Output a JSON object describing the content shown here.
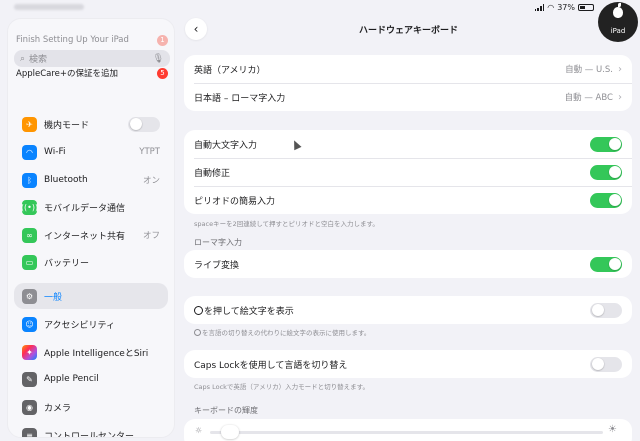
{
  "status_bar": {
    "battery": "37%"
  },
  "corner_logo": {
    "text": "iPad"
  },
  "sidebar": {
    "setup_items": [
      {
        "label": "Finish Setting Up Your iPad",
        "count": "1"
      },
      {
        "label": "AppleCare+の保証を追加",
        "count": "5"
      }
    ],
    "search_placeholder": "検索",
    "items": [
      {
        "label": "機内モード",
        "icon": "airplane-icon",
        "color": "#ff9500",
        "toggle": false
      },
      {
        "label": "Wi-Fi",
        "icon": "wifi-icon",
        "color": "#0a84ff",
        "value": "YTPT"
      },
      {
        "label": "Bluetooth",
        "icon": "bluetooth-icon",
        "color": "#0a84ff",
        "value": "オン"
      },
      {
        "label": "モバイルデータ通信",
        "icon": "antenna-icon",
        "color": "#34c759"
      },
      {
        "label": "インターネット共有",
        "icon": "link-icon",
        "color": "#34c759",
        "value": "オフ"
      },
      {
        "label": "バッテリー",
        "icon": "battery-icon",
        "color": "#34c759"
      },
      {
        "label": "一般",
        "icon": "gear-icon",
        "color": "#8e8e93",
        "active": true
      },
      {
        "label": "アクセシビリティ",
        "icon": "accessibility-icon",
        "color": "#0a84ff"
      },
      {
        "label": "Apple IntelligenceとSiri",
        "icon": "siri-icon",
        "color": "#ff2d55"
      },
      {
        "label": "Apple Pencil",
        "icon": "pencil-icon",
        "color": "#636366"
      },
      {
        "label": "カメラ",
        "icon": "camera-icon",
        "color": "#636366"
      },
      {
        "label": "コントロールセンター",
        "icon": "control-center-icon",
        "color": "#636366"
      }
    ]
  },
  "main": {
    "title": "ハードウェアキーボード",
    "keyboards": [
      {
        "label": "英語（アメリカ）",
        "value": "自動 — U.S."
      },
      {
        "label": "日本語 – ローマ字入力",
        "value": "自動 — ABC"
      }
    ],
    "typing": [
      {
        "label": "自動大文字入力",
        "on": true
      },
      {
        "label": "自動修正",
        "on": true
      },
      {
        "label": "ピリオドの簡易入力",
        "on": true
      }
    ],
    "typing_footnote": "spaceキーを2回連続して押すとピリオドと空白を入力します。",
    "romaji_header": "ローマ字入力",
    "live_conversion": {
      "label": "ライブ変換",
      "on": true
    },
    "emoji": {
      "label": "を押して絵文字を表示",
      "on": false
    },
    "emoji_footnote": "を言語の切り替えの代わりに絵文字の表示に使用します。",
    "caps_lock": {
      "label": "Caps Lockを使用して言語を切り替え",
      "on": false
    },
    "caps_footnote": "Caps Lockで英語（アメリカ）入力モードと切り替えます。",
    "brightness_header": "キーボードの輝度",
    "brightness_level": 0.03
  },
  "colors": {
    "accent": "#0a84ff",
    "toggle_on": "#34c759"
  }
}
